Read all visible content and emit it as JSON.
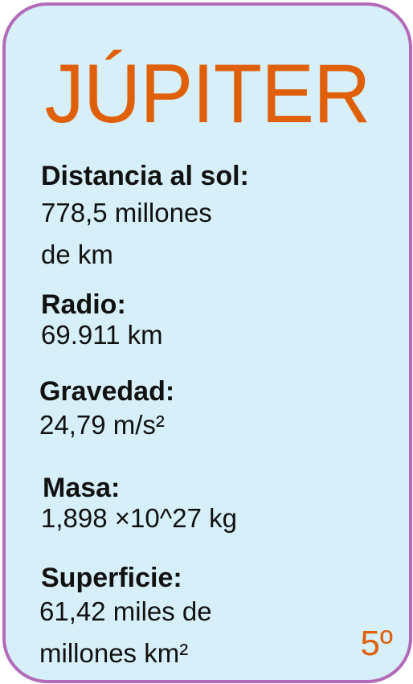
{
  "planet": {
    "name": "JÚPITER",
    "order": "5º"
  },
  "facts": {
    "distance": {
      "label": "Distancia al sol:",
      "value": "778,5 millones\nde km"
    },
    "radius": {
      "label": "Radio:",
      "value": "69.911 km"
    },
    "gravity": {
      "label": "Gravedad:",
      "value": "24,79 m/s²"
    },
    "mass": {
      "label": "Masa:",
      "value": "1,898 ×10^27 kg"
    },
    "surface": {
      "label": "Superficie:",
      "value": "61,42 miles de\nmillones km²"
    }
  },
  "colors": {
    "background": "#d6eff8",
    "border": "#b36ab8",
    "accent": "#e0600a",
    "text": "#111111"
  }
}
